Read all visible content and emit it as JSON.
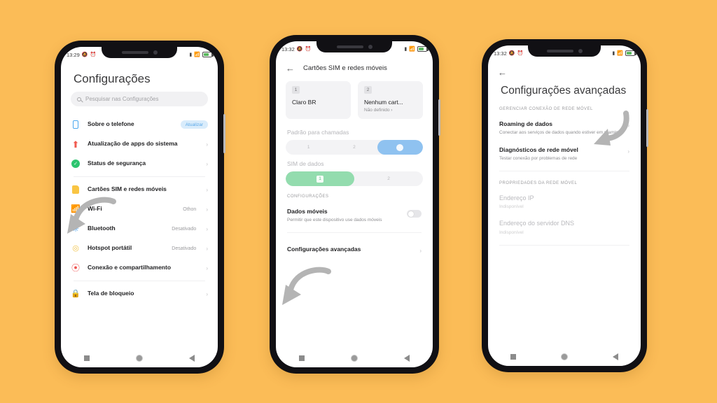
{
  "background_color": "#FBBC57",
  "phone1": {
    "statusbar": {
      "time": "13:29",
      "icons": [
        "silent-icon",
        "alarm-icon",
        "signal-icon",
        "wifi-icon",
        "battery-icon"
      ]
    },
    "page_title": "Configurações",
    "search_placeholder": "Pesquisar nas Configurações",
    "items": [
      {
        "label": "Sobre o telefone",
        "icon": "phone-icon",
        "badge": "Atualizar",
        "value": "",
        "chevron": false
      },
      {
        "label": "Atualização de apps do sistema",
        "icon": "update-arrow-icon",
        "badge": "",
        "value": "",
        "chevron": true
      },
      {
        "label": "Status de segurança",
        "icon": "shield-icon",
        "badge": "",
        "value": "",
        "chevron": true
      },
      {
        "label": "Cartões SIM e redes móveis",
        "icon": "sim-card-icon",
        "badge": "",
        "value": "",
        "chevron": true
      },
      {
        "label": "Wi-Fi",
        "icon": "wifi-icon",
        "badge": "",
        "value": "Othon",
        "chevron": true
      },
      {
        "label": "Bluetooth",
        "icon": "bluetooth-icon",
        "badge": "",
        "value": "Desativado",
        "chevron": true
      },
      {
        "label": "Hotspot portátil",
        "icon": "hotspot-icon",
        "badge": "",
        "value": "Desativado",
        "chevron": true
      },
      {
        "label": "Conexão e compartilhamento",
        "icon": "share-icon",
        "badge": "",
        "value": "",
        "chevron": true
      },
      {
        "label": "Tela de bloqueio",
        "icon": "lock-icon",
        "badge": "",
        "value": "",
        "chevron": true
      }
    ],
    "navbar": [
      "recents-icon",
      "home-icon",
      "back-icon"
    ]
  },
  "phone2": {
    "statusbar": {
      "time": "13:32"
    },
    "header_title": "Cartões SIM e redes móveis",
    "back_icon": "back-arrow-icon",
    "sim_cards": [
      {
        "slot": "1",
        "name": "Claro BR",
        "sub": ""
      },
      {
        "slot": "2",
        "name": "Nenhum cart...",
        "sub": "Não definido ›"
      }
    ],
    "calls_label": "Padrão para chamadas",
    "calls_options": [
      "1",
      "2",
      "ask-icon"
    ],
    "calls_selected": 2,
    "data_label": "SIM de dados",
    "data_options": [
      "1",
      "2"
    ],
    "data_selected": 0,
    "settings_label": "CONFIGURAÇÕES",
    "mobile_data": {
      "title": "Dados móveis",
      "subtitle": "Permitir que este dispositivo use dados móveis",
      "toggle_on": false
    },
    "advanced_label": "Configurações avançadas"
  },
  "phone3": {
    "statusbar": {
      "time": "13:32"
    },
    "back_icon": "back-arrow-icon",
    "page_title": "Configurações avançadas",
    "section1_label": "GERENCIAR CONEXÃO DE REDE MÓVEL",
    "section1_items": [
      {
        "title": "Roaming de dados",
        "subtitle": "Conectar aos serviços de dados quando estiver em roaming",
        "chevron": true
      },
      {
        "title": "Diagnósticos de rede móvel",
        "subtitle": "Testar conexão por problemas de rede",
        "chevron": true
      }
    ],
    "section2_label": "PROPRIEDADES DA REDE MÓVEL",
    "section2_items": [
      {
        "title": "Endereço IP",
        "subtitle": "Indisponível"
      },
      {
        "title": "Endereço do servidor DNS",
        "subtitle": "Indisponível"
      }
    ]
  }
}
